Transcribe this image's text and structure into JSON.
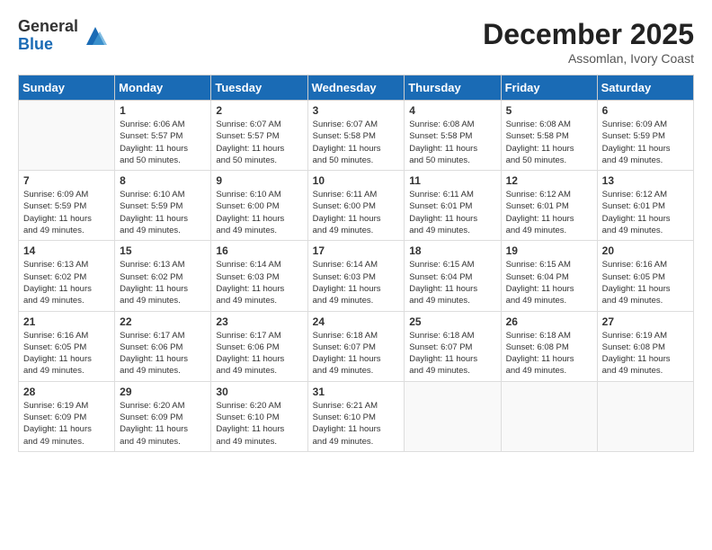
{
  "header": {
    "logo_general": "General",
    "logo_blue": "Blue",
    "month_title": "December 2025",
    "location": "Assomlan, Ivory Coast"
  },
  "calendar": {
    "days_of_week": [
      "Sunday",
      "Monday",
      "Tuesday",
      "Wednesday",
      "Thursday",
      "Friday",
      "Saturday"
    ],
    "weeks": [
      [
        {
          "day": "",
          "info": ""
        },
        {
          "day": "1",
          "info": "Sunrise: 6:06 AM\nSunset: 5:57 PM\nDaylight: 11 hours\nand 50 minutes."
        },
        {
          "day": "2",
          "info": "Sunrise: 6:07 AM\nSunset: 5:57 PM\nDaylight: 11 hours\nand 50 minutes."
        },
        {
          "day": "3",
          "info": "Sunrise: 6:07 AM\nSunset: 5:58 PM\nDaylight: 11 hours\nand 50 minutes."
        },
        {
          "day": "4",
          "info": "Sunrise: 6:08 AM\nSunset: 5:58 PM\nDaylight: 11 hours\nand 50 minutes."
        },
        {
          "day": "5",
          "info": "Sunrise: 6:08 AM\nSunset: 5:58 PM\nDaylight: 11 hours\nand 50 minutes."
        },
        {
          "day": "6",
          "info": "Sunrise: 6:09 AM\nSunset: 5:59 PM\nDaylight: 11 hours\nand 49 minutes."
        }
      ],
      [
        {
          "day": "7",
          "info": "Sunrise: 6:09 AM\nSunset: 5:59 PM\nDaylight: 11 hours\nand 49 minutes."
        },
        {
          "day": "8",
          "info": "Sunrise: 6:10 AM\nSunset: 5:59 PM\nDaylight: 11 hours\nand 49 minutes."
        },
        {
          "day": "9",
          "info": "Sunrise: 6:10 AM\nSunset: 6:00 PM\nDaylight: 11 hours\nand 49 minutes."
        },
        {
          "day": "10",
          "info": "Sunrise: 6:11 AM\nSunset: 6:00 PM\nDaylight: 11 hours\nand 49 minutes."
        },
        {
          "day": "11",
          "info": "Sunrise: 6:11 AM\nSunset: 6:01 PM\nDaylight: 11 hours\nand 49 minutes."
        },
        {
          "day": "12",
          "info": "Sunrise: 6:12 AM\nSunset: 6:01 PM\nDaylight: 11 hours\nand 49 minutes."
        },
        {
          "day": "13",
          "info": "Sunrise: 6:12 AM\nSunset: 6:01 PM\nDaylight: 11 hours\nand 49 minutes."
        }
      ],
      [
        {
          "day": "14",
          "info": "Sunrise: 6:13 AM\nSunset: 6:02 PM\nDaylight: 11 hours\nand 49 minutes."
        },
        {
          "day": "15",
          "info": "Sunrise: 6:13 AM\nSunset: 6:02 PM\nDaylight: 11 hours\nand 49 minutes."
        },
        {
          "day": "16",
          "info": "Sunrise: 6:14 AM\nSunset: 6:03 PM\nDaylight: 11 hours\nand 49 minutes."
        },
        {
          "day": "17",
          "info": "Sunrise: 6:14 AM\nSunset: 6:03 PM\nDaylight: 11 hours\nand 49 minutes."
        },
        {
          "day": "18",
          "info": "Sunrise: 6:15 AM\nSunset: 6:04 PM\nDaylight: 11 hours\nand 49 minutes."
        },
        {
          "day": "19",
          "info": "Sunrise: 6:15 AM\nSunset: 6:04 PM\nDaylight: 11 hours\nand 49 minutes."
        },
        {
          "day": "20",
          "info": "Sunrise: 6:16 AM\nSunset: 6:05 PM\nDaylight: 11 hours\nand 49 minutes."
        }
      ],
      [
        {
          "day": "21",
          "info": "Sunrise: 6:16 AM\nSunset: 6:05 PM\nDaylight: 11 hours\nand 49 minutes."
        },
        {
          "day": "22",
          "info": "Sunrise: 6:17 AM\nSunset: 6:06 PM\nDaylight: 11 hours\nand 49 minutes."
        },
        {
          "day": "23",
          "info": "Sunrise: 6:17 AM\nSunset: 6:06 PM\nDaylight: 11 hours\nand 49 minutes."
        },
        {
          "day": "24",
          "info": "Sunrise: 6:18 AM\nSunset: 6:07 PM\nDaylight: 11 hours\nand 49 minutes."
        },
        {
          "day": "25",
          "info": "Sunrise: 6:18 AM\nSunset: 6:07 PM\nDaylight: 11 hours\nand 49 minutes."
        },
        {
          "day": "26",
          "info": "Sunrise: 6:18 AM\nSunset: 6:08 PM\nDaylight: 11 hours\nand 49 minutes."
        },
        {
          "day": "27",
          "info": "Sunrise: 6:19 AM\nSunset: 6:08 PM\nDaylight: 11 hours\nand 49 minutes."
        }
      ],
      [
        {
          "day": "28",
          "info": "Sunrise: 6:19 AM\nSunset: 6:09 PM\nDaylight: 11 hours\nand 49 minutes."
        },
        {
          "day": "29",
          "info": "Sunrise: 6:20 AM\nSunset: 6:09 PM\nDaylight: 11 hours\nand 49 minutes."
        },
        {
          "day": "30",
          "info": "Sunrise: 6:20 AM\nSunset: 6:10 PM\nDaylight: 11 hours\nand 49 minutes."
        },
        {
          "day": "31",
          "info": "Sunrise: 6:21 AM\nSunset: 6:10 PM\nDaylight: 11 hours\nand 49 minutes."
        },
        {
          "day": "",
          "info": ""
        },
        {
          "day": "",
          "info": ""
        },
        {
          "day": "",
          "info": ""
        }
      ]
    ]
  }
}
